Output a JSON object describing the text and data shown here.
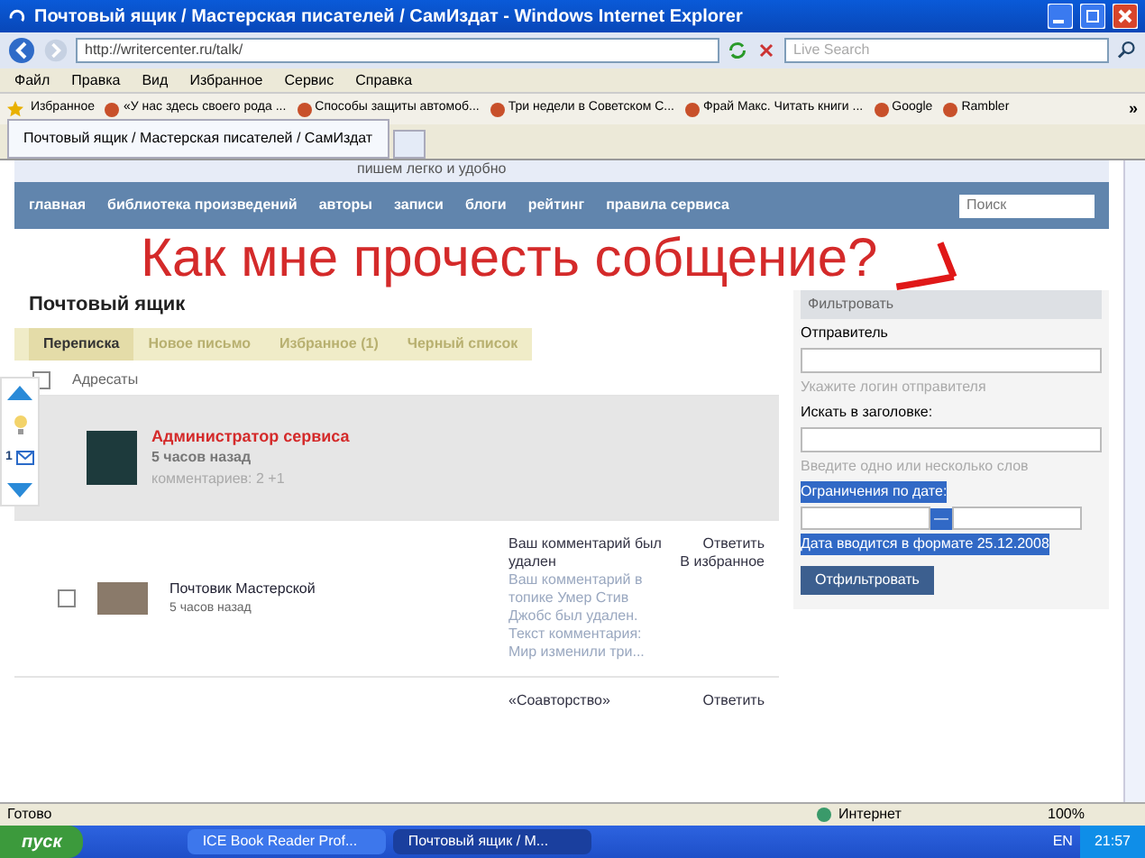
{
  "window": {
    "title": "Почтовый ящик / Мастерская писателей / СамИздат - Windows Internet Explorer"
  },
  "address_bar": {
    "url": "http://writercenter.ru/talk/",
    "search_placeholder": "Live Search"
  },
  "menu": [
    "Файл",
    "Правка",
    "Вид",
    "Избранное",
    "Сервис",
    "Справка"
  ],
  "favorites_bar": {
    "label": "Избранное",
    "links": [
      "«У нас здесь своего рода ...",
      "Способы защиты автомоб...",
      "Три недели в Советском С...",
      "Фрай Макс. Читать книги ...",
      "Google",
      "Rambler"
    ],
    "more": "»"
  },
  "browser_tabs": [
    {
      "title": "Почтовый ящик / Мастерская писателей / СамИздат",
      "selected": true
    }
  ],
  "site": {
    "tagline": "пишем легко и удобно",
    "nav": [
      "главная",
      "библиотека произведений",
      "авторы",
      "записи",
      "блоги",
      "рейтинг",
      "правила сервиса"
    ],
    "search_placeholder": "Поиск"
  },
  "annotation": "Как мне прочесть собщение?",
  "mailbox": {
    "title": "Почтовый ящик",
    "tabs": [
      {
        "label": "Переписка",
        "selected": true
      },
      {
        "label": "Новое письмо",
        "selected": false
      },
      {
        "label": "Избранное (1)",
        "selected": false
      },
      {
        "label": "Черный список",
        "selected": false
      }
    ],
    "column": "Адресаты",
    "select_all_checked": false,
    "rows": [
      {
        "kind": "summary",
        "highlighted": true,
        "sender": "Администратор сервиса",
        "time": "5 часов назад",
        "comments": "комментариев: 2 +1"
      },
      {
        "kind": "message",
        "highlighted": false,
        "checked": false,
        "sender": "Почтовик Мастерской",
        "time": "5 часов назад",
        "subject": "Ваш комментарий был удален",
        "preview": "Ваш комментарий в топике Умер Стив Джобс был удален. Текст комментария: Мир изменили три...",
        "actions": [
          "Ответить",
          "В избранное"
        ]
      },
      {
        "kind": "message",
        "highlighted": false,
        "subject": "«Соавторство»",
        "actions": [
          "Ответить"
        ]
      }
    ]
  },
  "filter": {
    "title": "Фильтровать",
    "sender_label": "Отправитель",
    "sender_hint": "Укажите логин отправителя",
    "title_label": "Искать в заголовке:",
    "title_hint": "Введите одно или несколько слов",
    "date_label": "Ограничения по дате:",
    "date_separator": "—",
    "date_hint": "Дата вводится в формате 25.12.2008",
    "button": "Отфильтровать"
  },
  "side_widget": {
    "count": "1"
  },
  "status_bar": {
    "text": "Готово",
    "zone": "Интернет",
    "zoom": "100%"
  },
  "taskbar": {
    "start": "пуск",
    "tasks": [
      {
        "label": "ICE Book Reader Prof...",
        "selected": false
      },
      {
        "label": "Почтовый ящик / M...",
        "selected": true
      }
    ],
    "language": "EN",
    "clock": "21:57"
  }
}
